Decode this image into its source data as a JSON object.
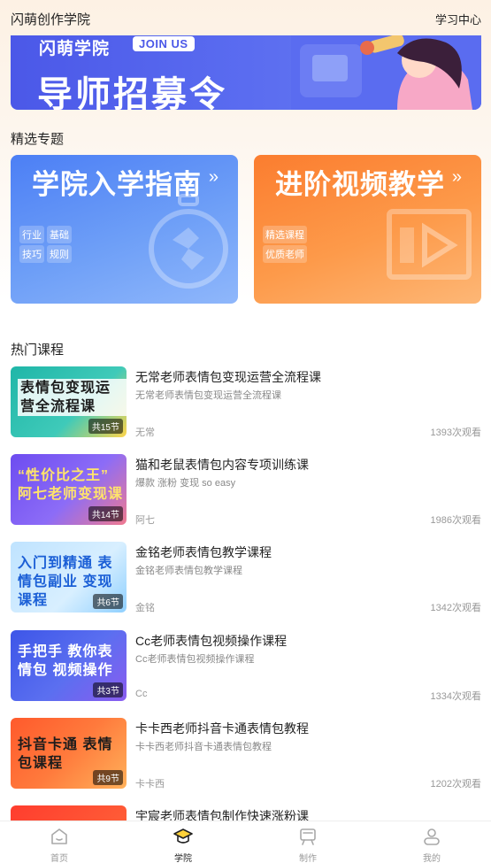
{
  "header": {
    "app_title": "闪萌创作学院",
    "study_center": "学习中心"
  },
  "banner": {
    "small_text": "闪萌学院",
    "join_badge": "JOIN US",
    "headline": "导师招募令"
  },
  "featured": {
    "section_title": "精选专题",
    "cards": [
      {
        "title": "学院入学指南",
        "arrow": "»",
        "tags": [
          "行业",
          "基础",
          "技巧",
          "规则"
        ],
        "color": "#4c7ff5"
      },
      {
        "title": "进阶视频教学",
        "arrow": "»",
        "tags": [
          "精选课程",
          "优质老师"
        ],
        "color": "#fb7d2f"
      }
    ]
  },
  "hot": {
    "section_title": "热门课程",
    "courses": [
      {
        "thumb_text": "表情包变现运营全流程课",
        "lessons": "共15节",
        "title": "无常老师表情包变现运营全流程课",
        "subtitle": "无常老师表情包变现运营全流程课",
        "author": "无常",
        "views": "1393次观看"
      },
      {
        "thumb_text": "“性价比之王” 阿七老师变现课",
        "lessons": "共14节",
        "title": "猫和老鼠表情包内容专项训练课",
        "subtitle": "爆款 涨粉 变现 so easy",
        "author": "阿七",
        "views": "1986次观看"
      },
      {
        "thumb_text": "入门到精通 表情包副业 变现课程",
        "lessons": "共6节",
        "title": "金铭老师表情包教学课程",
        "subtitle": "金铭老师表情包教学课程",
        "author": "金铭",
        "views": "1342次观看"
      },
      {
        "thumb_text": "手把手 教你表情包 视频操作",
        "lessons": "共3节",
        "title": "Cc老师表情包视频操作课程",
        "subtitle": "Cc老师表情包视频操作课程",
        "author": "Cc",
        "views": "1334次观看"
      },
      {
        "thumb_text": "抖音卡通 表情包课程",
        "lessons": "共9节",
        "title": "卡卡西老师抖音卡通表情包教程",
        "subtitle": "卡卡西老师抖音卡通表情包教程",
        "author": "卡卡西",
        "views": "1202次观看"
      },
      {
        "thumb_text": "",
        "lessons": "",
        "title": "宇宸老师表情包制作快速涨粉课",
        "subtitle": "",
        "author": "",
        "views": ""
      }
    ]
  },
  "tabbar": {
    "items": [
      {
        "label": "首页",
        "icon": "home-icon"
      },
      {
        "label": "学院",
        "icon": "graduation-cap-icon",
        "active": true
      },
      {
        "label": "制作",
        "icon": "easel-icon"
      },
      {
        "label": "我的",
        "icon": "profile-icon"
      }
    ]
  }
}
